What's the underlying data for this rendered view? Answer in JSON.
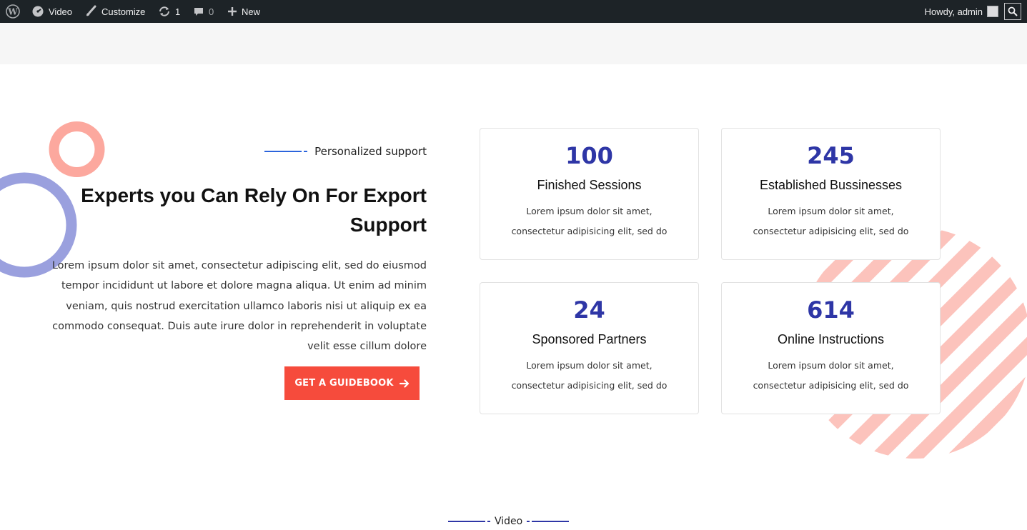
{
  "admin_bar": {
    "site_name": "Video",
    "customize": "Customize",
    "updates_count": "1",
    "comments_count": "0",
    "new_label": "New",
    "greeting": "Howdy, admin"
  },
  "colors": {
    "admin_bar_bg": "#1d2327",
    "accent_blue": "#2e36a6",
    "cta_red": "#f64b3c",
    "deco_salmon": "#fca89e",
    "deco_periwinkle": "#9aa0de"
  },
  "hero": {
    "eyebrow": "Personalized support",
    "title_line1": "Experts you Can Rely On For Export",
    "title_line2": "Support",
    "body": "Lorem ipsum dolor sit amet, consectetur adipiscing elit, sed do eiusmod tempor incididunt ut labore et dolore magna aliqua. Ut enim ad minim veniam, quis nostrud exercitation ullamco laboris nisi ut aliquip ex ea commodo consequat. Duis aute irure dolor in reprehenderit in voluptate velit esse cillum dolore",
    "cta_label": "GET A GUIDEBOOK"
  },
  "stats": [
    {
      "number": "100",
      "title": "Finished Sessions",
      "desc": "Lorem ipsum dolor sit amet, consectetur adipisicing elit, sed do"
    },
    {
      "number": "245",
      "title": "Established Bussinesses",
      "desc": "Lorem ipsum dolor sit amet, consectetur adipisicing elit, sed do"
    },
    {
      "number": "24",
      "title": "Sponsored Partners",
      "desc": "Lorem ipsum dolor sit amet, consectetur adipisicing elit, sed do"
    },
    {
      "number": "614",
      "title": "Online Instructions",
      "desc": "Lorem ipsum dolor sit amet, consectetur adipisicing elit, sed do"
    }
  ],
  "video_section": {
    "label": "Video"
  }
}
